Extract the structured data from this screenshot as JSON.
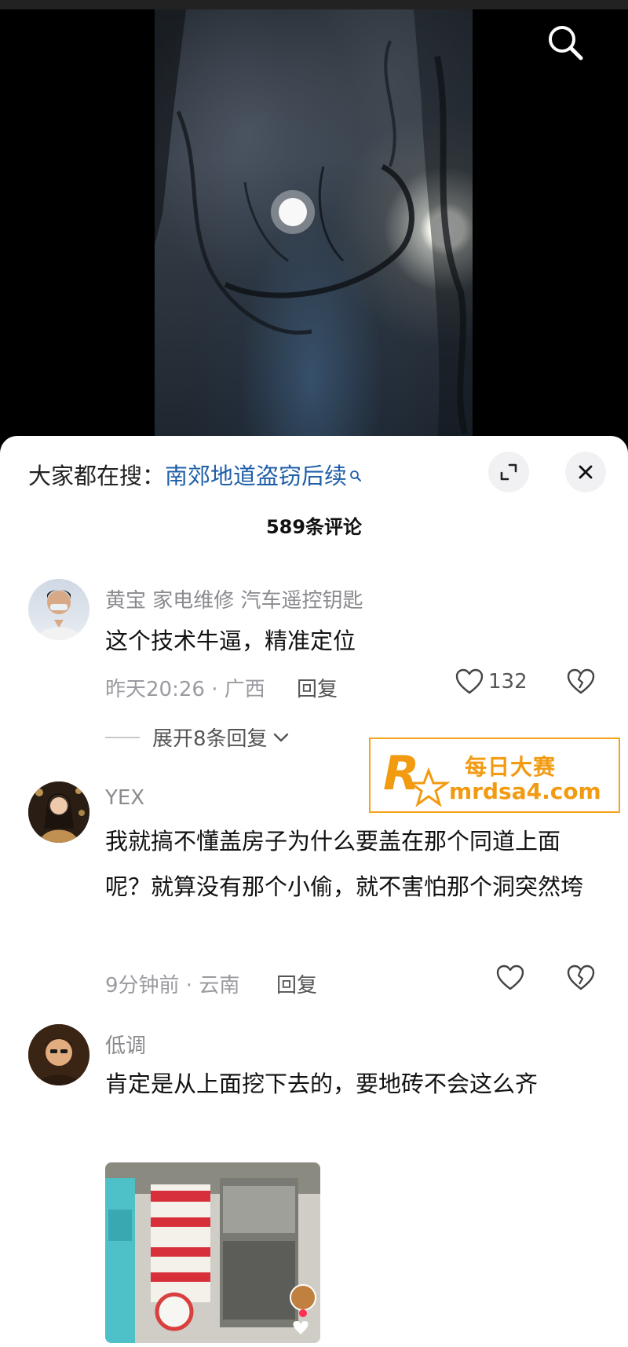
{
  "video": {
    "search_icon": "search-icon"
  },
  "sheet": {
    "search_prefix": "大家都在搜：",
    "search_term": "南郊地道盗窃后续",
    "comment_count": "589条评论"
  },
  "comments": [
    {
      "user": "黄宝 家电维修 汽车遥控钥匙",
      "text": "这个技术牛逼，精准定位",
      "meta": "昨天20:26 · 广西",
      "reply_label": "回复",
      "likes": "132",
      "expand_label": "展开8条回复"
    },
    {
      "user": "YEX",
      "text": "我就搞不懂盖房子为什么要盖在那个同道上面呢？就算没有那个小偷，就不害怕那个洞突然垮",
      "meta": "9分钟前 · 云南",
      "reply_label": "回复"
    },
    {
      "user": "低调",
      "text": "肯定是从上面挖下去的，要地砖不会这么齐"
    }
  ],
  "watermark": {
    "name": "每日大赛",
    "url": "mrdsa4.com",
    "logo_letter": "R"
  },
  "colors": {
    "link_blue": "#1f5fa8",
    "watermark_orange": "#f29a10"
  }
}
